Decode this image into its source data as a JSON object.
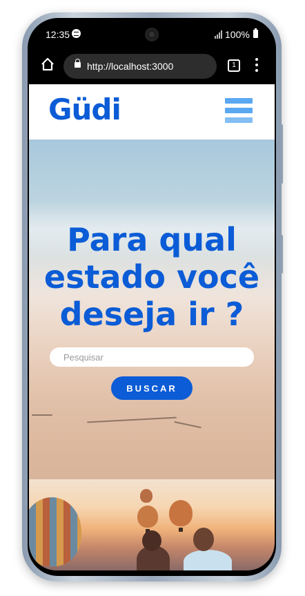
{
  "status_bar": {
    "time": "12:35",
    "battery": "100%",
    "music_icon": "spotify-icon",
    "signal_icon": "signal-icon",
    "battery_icon": "battery-icon"
  },
  "browser": {
    "url": "http://localhost:3000",
    "tab_count": "1",
    "home_icon": "home-icon",
    "lock_icon": "lock-icon",
    "menu_icon": "more-vert-icon"
  },
  "site": {
    "logo": "Güdi",
    "menu_icon": "hamburger-icon",
    "brand_color": "#0b5cd6",
    "menu_color": "#5aa8f2"
  },
  "hero": {
    "title_line1": "Para qual",
    "title_line2": "estado você",
    "title_line3": "deseja ir ?",
    "search_placeholder": "Pesquisar",
    "search_value": "",
    "button_label": "BUSCAR"
  }
}
